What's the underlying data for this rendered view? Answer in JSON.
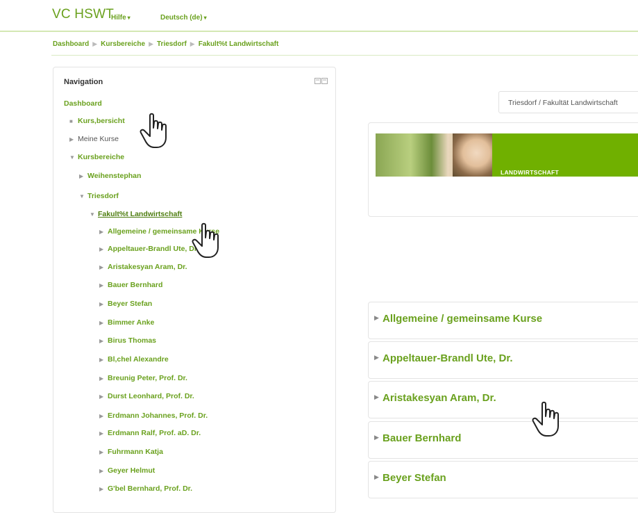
{
  "header": {
    "site_title": "VC HSWT",
    "menu": [
      {
        "label": "Hilfe",
        "caret": "▾"
      },
      {
        "label": "Deutsch (de)",
        "caret": "▾"
      }
    ]
  },
  "breadcrumb": {
    "items": [
      "Dashboard",
      "Kursbereiche",
      "Triesdorf",
      "Fakult%t Landwirtschaft"
    ],
    "separator": "▶"
  },
  "navigation": {
    "title": "Navigation",
    "dock_icon": "dock-icon",
    "items": [
      {
        "label": "Dashboard"
      },
      {
        "label": "Kurs,bersicht"
      },
      {
        "label": "Meine Kurse"
      },
      {
        "label": "Kursbereiche"
      },
      {
        "label": "Weihenstephan"
      },
      {
        "label": "Triesdorf"
      },
      {
        "label": "Fakult%t Landwirtschaft"
      },
      {
        "label": "Allgemeine / gemeinsame Kurse"
      },
      {
        "label": "Appeltauer-Brandl Ute, Dr."
      },
      {
        "label": "Aristakesyan Aram, Dr."
      },
      {
        "label": "Bauer Bernhard"
      },
      {
        "label": "Beyer Stefan"
      },
      {
        "label": "Bimmer Anke"
      },
      {
        "label": "Birus Thomas"
      },
      {
        "label": "Bl,chel Alexandre"
      },
      {
        "label": "Breunig Peter, Prof. Dr."
      },
      {
        "label": "Durst Leonhard, Prof. Dr."
      },
      {
        "label": "Erdmann Johannes, Prof. Dr."
      },
      {
        "label": "Erdmann Ralf, Prof. aD. Dr."
      },
      {
        "label": "Fuhrmann Katja"
      },
      {
        "label": "Geyer Helmut"
      },
      {
        "label": "G'bel Bernhard, Prof. Dr."
      }
    ]
  },
  "course_search": {
    "value": "Triesdorf / Fakultät Landwirtschaft"
  },
  "banner": {
    "label": "LANDWIRTSCHAFT"
  },
  "categories": [
    {
      "name": "Allgemeine / gemeinsame Kurse"
    },
    {
      "name": "Appeltauer-Brandl Ute, Dr."
    },
    {
      "name": "Aristakesyan Aram, Dr."
    },
    {
      "name": "Bauer Bernhard"
    },
    {
      "name": "Beyer Stefan"
    }
  ],
  "colors": {
    "accent": "#6aa11e",
    "banner_green": "#70b000"
  }
}
